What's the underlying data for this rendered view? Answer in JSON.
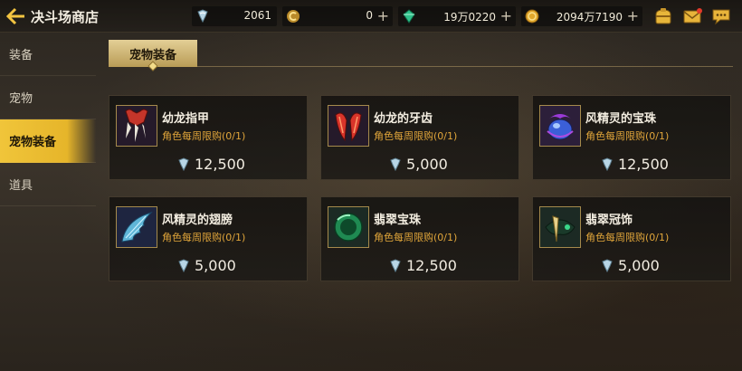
{
  "header": {
    "title": "决斗场商店",
    "currencies": [
      {
        "name": "trophy-token",
        "value": "2061",
        "has_plus": false
      },
      {
        "name": "gold-coin-c",
        "value": "0",
        "has_plus": true
      },
      {
        "name": "green-crystal",
        "value": "19万0220",
        "has_plus": true
      },
      {
        "name": "gold-coin",
        "value": "2094万7190",
        "has_plus": true
      }
    ],
    "plus_label": "+",
    "icons": [
      "bag-icon",
      "mail-icon",
      "chat-icon"
    ]
  },
  "sidebar": {
    "items": [
      {
        "label": "装备",
        "active": false
      },
      {
        "label": "宠物",
        "active": false
      },
      {
        "label": "宠物装备",
        "active": true
      },
      {
        "label": "道具",
        "active": false
      }
    ]
  },
  "tabs": {
    "active": "宠物装备"
  },
  "items": [
    {
      "name": "幼龙指甲",
      "limit": "角色每周限购(0/1)",
      "price": "12,500",
      "thumb": "claw"
    },
    {
      "name": "幼龙的牙齿",
      "limit": "角色每周限购(0/1)",
      "price": "5,000",
      "thumb": "teeth"
    },
    {
      "name": "风精灵的宝珠",
      "limit": "角色每周限购(0/1)",
      "price": "12,500",
      "thumb": "orb"
    },
    {
      "name": "风精灵的翅膀",
      "limit": "角色每周限购(0/1)",
      "price": "5,000",
      "thumb": "wing"
    },
    {
      "name": "翡翠宝珠",
      "limit": "角色每周限购(0/1)",
      "price": "12,500",
      "thumb": "emerald"
    },
    {
      "name": "翡翠冠饰",
      "limit": "角色每周限购(0/1)",
      "price": "5,000",
      "thumb": "crown"
    }
  ],
  "colors": {
    "accent": "#f0c53a",
    "limit_text": "#e0a53a"
  }
}
